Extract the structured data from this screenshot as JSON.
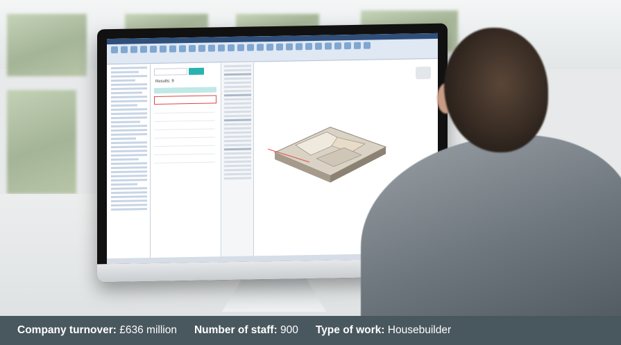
{
  "screen": {
    "results_label": "Results: 9"
  },
  "footer": {
    "turnover_label": "Company turnover:",
    "turnover_value": "£636 million",
    "staff_label": "Number of staff:",
    "staff_value": "900",
    "work_label": "Type of work:",
    "work_value": "Housebuilder"
  },
  "colors": {
    "footer_bg": "#49575e",
    "ribbon": "#dfe8f3",
    "highlight_row": "#bfe8e6",
    "selection_box": "#dd4444"
  }
}
